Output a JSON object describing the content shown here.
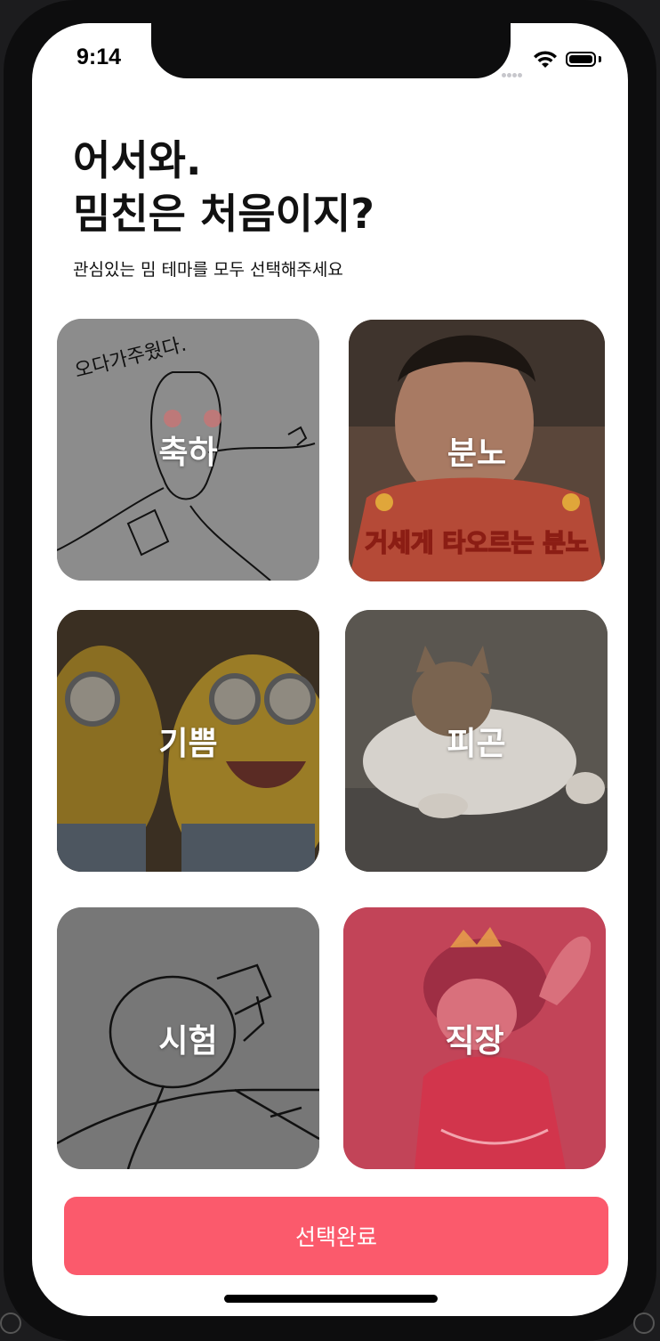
{
  "status_bar": {
    "time": "9:14"
  },
  "header": {
    "title_line1": "어서와.",
    "title_line2": "밈친은 처음이지?",
    "subtitle": "관심있는 밈 테마를 모두 선택해주세요"
  },
  "themes": [
    {
      "label": "축하",
      "image_caption": "오다가주웠다."
    },
    {
      "label": "분노",
      "image_caption": "거세게 타오르는 분노"
    },
    {
      "label": "기쁨"
    },
    {
      "label": "피곤"
    },
    {
      "label": "시험"
    },
    {
      "label": "직장"
    }
  ],
  "footer": {
    "confirm_label": "선택완료"
  },
  "colors": {
    "accent": "#fb5a6c",
    "background": "#ffffff",
    "title": "#111111"
  }
}
